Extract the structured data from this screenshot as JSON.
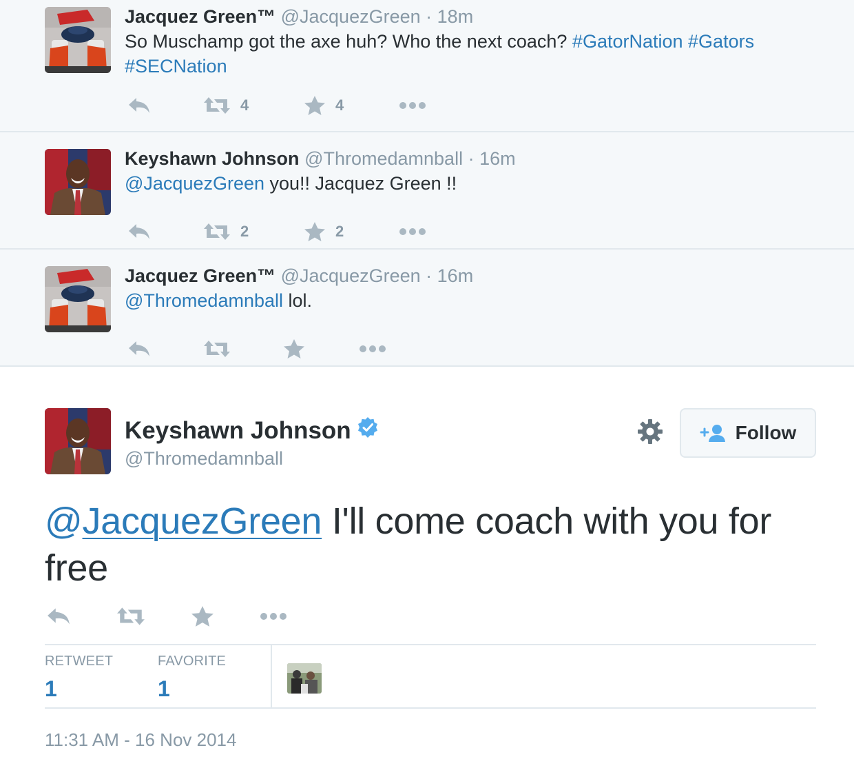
{
  "conversation": [
    {
      "name": "Jacquez Green™",
      "handle": "@JacquezGreen",
      "dot": "·",
      "time": "18m",
      "text_plain": "So Muschamp got the axe huh? Who the next coach?",
      "hashtags": [
        "#GatorNation",
        "#Gators",
        "#SECNation"
      ],
      "retweets": "4",
      "favorites": "4"
    },
    {
      "name": "Keyshawn Johnson",
      "handle": "@Thromedamnball",
      "dot": "·",
      "time": "16m",
      "mention": "@JacquezGreen",
      "text_plain": " you!! Jacquez Green !!",
      "retweets": "2",
      "favorites": "2"
    },
    {
      "name": "Jacquez Green™",
      "handle": "@JacquezGreen",
      "dot": "·",
      "time": "16m",
      "mention": "@Thromedamnball",
      "text_plain": " lol.",
      "retweets": "",
      "favorites": ""
    }
  ],
  "main_tweet": {
    "name": "Keyshawn Johnson",
    "handle": "@Thromedamnball",
    "follow_label": "Follow",
    "mention_at": "@",
    "mention_name": "JacquezGreen",
    "text_plain": " I'll come coach with you for free",
    "retweet_label": "RETWEET",
    "retweet_count": "1",
    "favorite_label": "FAVORITE",
    "favorite_count": "1",
    "timestamp": "11:31 AM - 16 Nov 2014"
  },
  "icons": [
    "reply-icon",
    "retweet-icon",
    "favorite-star-icon",
    "more-icon",
    "gear-icon",
    "follow-person-icon",
    "verified-badge-icon"
  ],
  "colors": {
    "link": "#2b7bb9",
    "muted": "#8899a6",
    "icon": "#aab8c2",
    "text": "#292f33",
    "convo_bg": "#f5f8fa",
    "border": "#e1e8ed",
    "verified": "#55acee"
  }
}
